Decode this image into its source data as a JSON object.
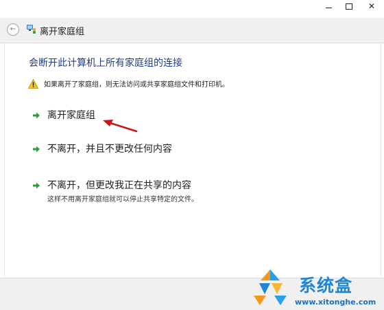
{
  "window": {
    "minimize_label": "",
    "maximize_label": "",
    "close_label": "✕"
  },
  "nav": {
    "back_glyph": "←",
    "title": "离开家庭组",
    "icon": "homegroup-icon"
  },
  "content": {
    "heading": "会断开此计算机上所有家庭组的连接",
    "warning_text": "如果离开了家庭组，则无法访问或共享家庭组文件和打印机。",
    "warning_icon": "warning-icon",
    "options": [
      {
        "label": "离开家庭组",
        "description": ""
      },
      {
        "label": "不离开，并且不更改任何内容",
        "description": ""
      },
      {
        "label": "不离开，但更改我正在共享的内容",
        "description": "这样不用离开家庭组就可以停止共享特定的文件。"
      }
    ],
    "option_icon": "green-arrow-icon"
  },
  "watermark": {
    "brand": "系统盒",
    "url": "www.xitonghe.com"
  },
  "colors": {
    "heading": "#1f3c88",
    "arrow_green": "#2e9a3a",
    "annotation_red": "#c8141b",
    "watermark_blue": "#1f86d4",
    "watermark_orange": "#f39a1e"
  }
}
